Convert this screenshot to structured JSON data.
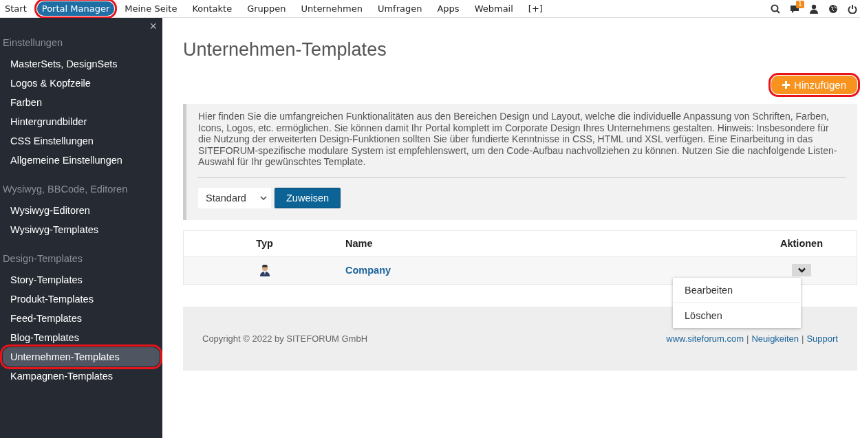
{
  "top_nav": {
    "items": [
      {
        "label": "Start",
        "selected": false,
        "highlighted": false
      },
      {
        "label": "Portal Manager",
        "selected": true,
        "highlighted": true
      },
      {
        "label": "Meine Seite",
        "selected": false,
        "highlighted": false
      },
      {
        "label": "Kontakte",
        "selected": false,
        "highlighted": false
      },
      {
        "label": "Gruppen",
        "selected": false,
        "highlighted": false
      },
      {
        "label": "Unternehmen",
        "selected": false,
        "highlighted": false
      },
      {
        "label": "Umfragen",
        "selected": false,
        "highlighted": false
      },
      {
        "label": "Apps",
        "selected": false,
        "highlighted": false
      },
      {
        "label": "Webmail",
        "selected": false,
        "highlighted": false
      },
      {
        "label": "[+]",
        "selected": false,
        "highlighted": false
      }
    ],
    "message_badge": "1"
  },
  "sidebar": {
    "close": "×",
    "sections": [
      {
        "title": "Einstellungen",
        "items": [
          {
            "label": "MasterSets, DesignSets",
            "selected": false,
            "highlighted": false
          },
          {
            "label": "Logos & Kopfzeile",
            "selected": false,
            "highlighted": false
          },
          {
            "label": "Farben",
            "selected": false,
            "highlighted": false
          },
          {
            "label": "Hintergrundbilder",
            "selected": false,
            "highlighted": false
          },
          {
            "label": "CSS Einstellungen",
            "selected": false,
            "highlighted": false
          },
          {
            "label": "Allgemeine Einstellungen",
            "selected": false,
            "highlighted": false
          }
        ]
      },
      {
        "title": "Wysiwyg, BBCode, Editoren",
        "items": [
          {
            "label": "Wysiwyg-Editoren",
            "selected": false,
            "highlighted": false
          },
          {
            "label": "Wysiwyg-Templates",
            "selected": false,
            "highlighted": false
          }
        ]
      },
      {
        "title": "Design-Templates",
        "items": [
          {
            "label": "Story-Templates",
            "selected": false,
            "highlighted": false
          },
          {
            "label": "Produkt-Templates",
            "selected": false,
            "highlighted": false
          },
          {
            "label": "Feed-Templates",
            "selected": false,
            "highlighted": false
          },
          {
            "label": "Blog-Templates",
            "selected": false,
            "highlighted": false
          },
          {
            "label": "Unternehmen-Templates",
            "selected": true,
            "highlighted": true
          },
          {
            "label": "Kampagnen-Templates",
            "selected": false,
            "highlighted": false
          }
        ]
      }
    ]
  },
  "page": {
    "title": "Unternehmen-Templates",
    "add_button": {
      "label": "Hinzufügen",
      "highlighted": true
    },
    "info": {
      "text": "Hier finden Sie die umfangreichen Funktionalitäten aus den Bereichen Design und Layout, welche die individuelle Anpassung von Schriften, Farben, Icons, Logos, etc. ermöglichen. Sie können damit Ihr Portal komplett im Corporate Design Ihres Unternehmens gestalten. Hinweis: Insbesondere für die Nutzung der erweiterten Design-Funktionen sollten Sie über fundierte Kenntnisse in CSS, HTML und XSL verfügen. Eine Einarbeitung in das SITEFORUM-spezifische modulare System ist empfehlenswert, um den Code-Aufbau nachvollziehen zu können. Nutzen Sie die nachfolgende Listen-Auswahl für Ihr gewünschtes Template.",
      "select_value": "Standard",
      "assign_button": "Zuweisen"
    },
    "table": {
      "columns": [
        "Typ",
        "Name",
        "Aktionen"
      ],
      "rows": [
        {
          "name": "Company",
          "menu_open": true,
          "menu": [
            "Bearbeiten",
            "Löschen"
          ]
        }
      ]
    }
  },
  "footer": {
    "copyright": "Copyright © 2022 by SITEFORUM GmbH",
    "links": [
      {
        "kind": "link",
        "text": "www.siteforum.com"
      },
      {
        "kind": "separator",
        "text": "|"
      },
      {
        "kind": "link",
        "text": "Neuigkeiten"
      },
      {
        "kind": "separator",
        "text": "|"
      },
      {
        "kind": "link",
        "text": "Support"
      }
    ]
  }
}
